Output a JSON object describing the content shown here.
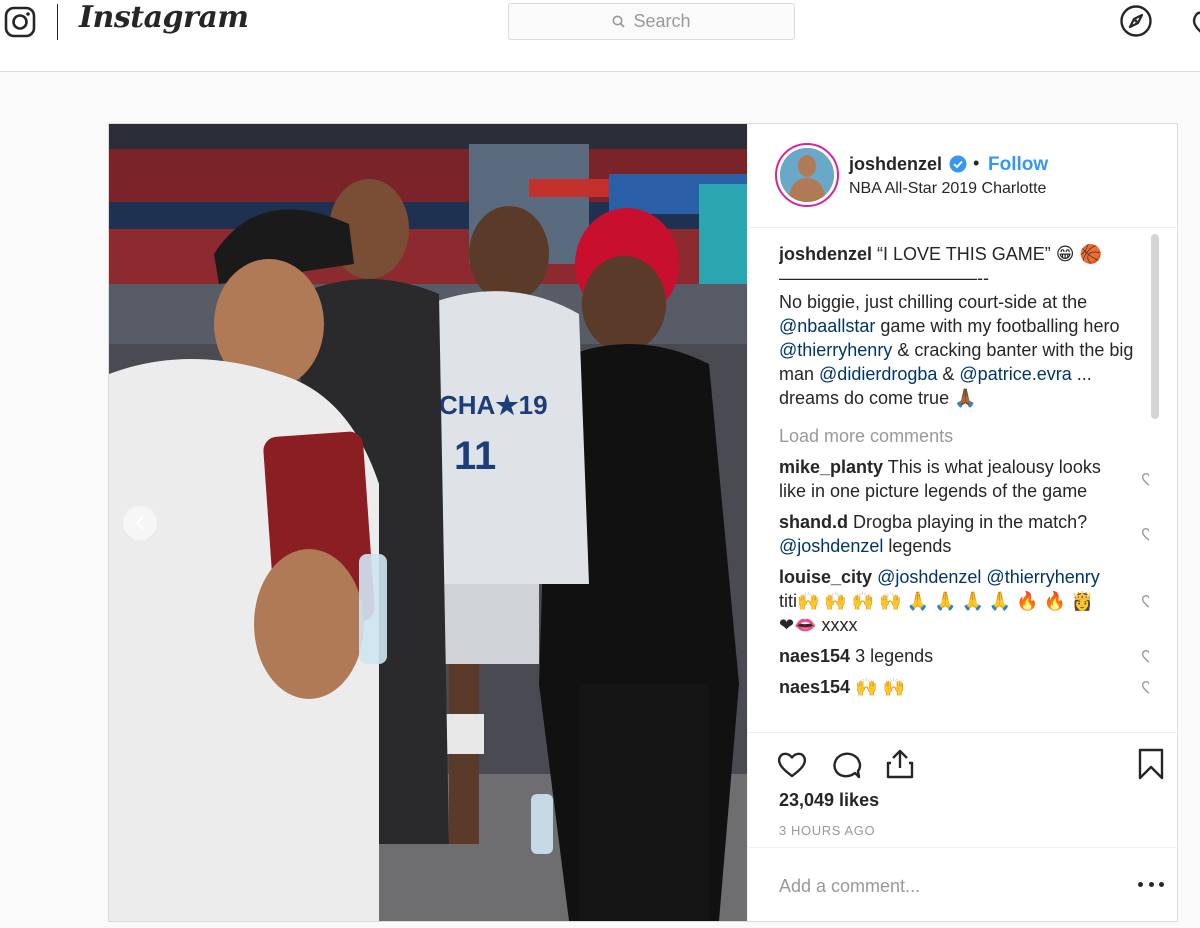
{
  "topbar": {
    "brand": "Instagram",
    "search_placeholder": "Search"
  },
  "post": {
    "username": "joshdenzel",
    "follow_label": "Follow",
    "dot": "•",
    "location": "NBA All-Star 2019 Charlotte",
    "caption": {
      "username": "joshdenzel",
      "headline": "“I LOVE THIS GAME” 😁 🏀",
      "separator": "———————————--",
      "part1": "No biggie, just chilling court-side at the ",
      "mention1": "@nbaallstar",
      "part2": " game with my footballing hero ",
      "mention2": "@thierryhenry",
      "part3": " & cracking banter with the big man ",
      "mention3": "@didierdrogba",
      "part4": " & ",
      "mention4": "@patrice.evra",
      "part5": " ... dreams do come true 🙏🏾"
    },
    "load_more": "Load more comments",
    "comments": [
      {
        "user": "mike_planty",
        "text": "This is what jealousy looks like in one picture legends of the game"
      },
      {
        "user": "shand.d",
        "text": "Drogba playing in the match?",
        "mention": "@joshdenzel",
        "text_after": " legends"
      },
      {
        "user": "louise_city",
        "mention": "@joshdenzel",
        "mention2": "@thierryhenry",
        "text": " titi🙌 🙌 🙌 🙌 🙏 🙏 🙏 🙏 🔥 🔥 👸 ❤👄 xxxx"
      },
      {
        "user": "naes154",
        "text": "3 legends"
      },
      {
        "user": "naes154",
        "text": "🙌 🙌"
      }
    ],
    "likes": "23,049 likes",
    "time": "3 HOURS AGO",
    "add_comment_placeholder": "Add a comment..."
  },
  "colors": {
    "accent": "#3897f0",
    "mention": "#003569",
    "muted": "#999999",
    "border": "#dbdbdb"
  },
  "icons": {
    "logo": "instagram-camera-icon",
    "search": "search-icon",
    "explore": "compass-icon",
    "verified": "verified-badge-icon",
    "like": "heart-icon",
    "comment": "comment-bubble-icon",
    "share": "share-icon",
    "save": "bookmark-icon",
    "more": "more-options-icon",
    "prev": "chevron-left-icon"
  }
}
